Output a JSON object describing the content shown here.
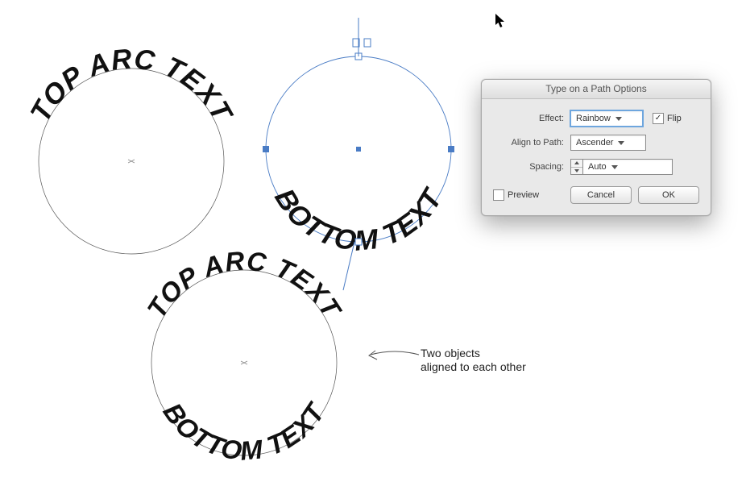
{
  "canvas": {
    "circle1": {
      "top_text": "TOP ARC TEXT"
    },
    "circle2": {
      "bottom_text": "BOTTOM TEXT"
    },
    "circle3": {
      "top_text": "TOP ARC TEXT",
      "bottom_text": "BOTTOM TEXT"
    }
  },
  "annotation": {
    "line1": "Two objects",
    "line2": "aligned to each other"
  },
  "dialog": {
    "title": "Type on a Path Options",
    "labels": {
      "effect": "Effect:",
      "align": "Align to Path:",
      "spacing": "Spacing:"
    },
    "effect_value": "Rainbow",
    "flip_label": "Flip",
    "flip_checked": true,
    "align_value": "Ascender",
    "spacing_value": "Auto",
    "preview_label": "Preview",
    "preview_checked": false,
    "cancel_label": "Cancel",
    "ok_label": "OK"
  }
}
